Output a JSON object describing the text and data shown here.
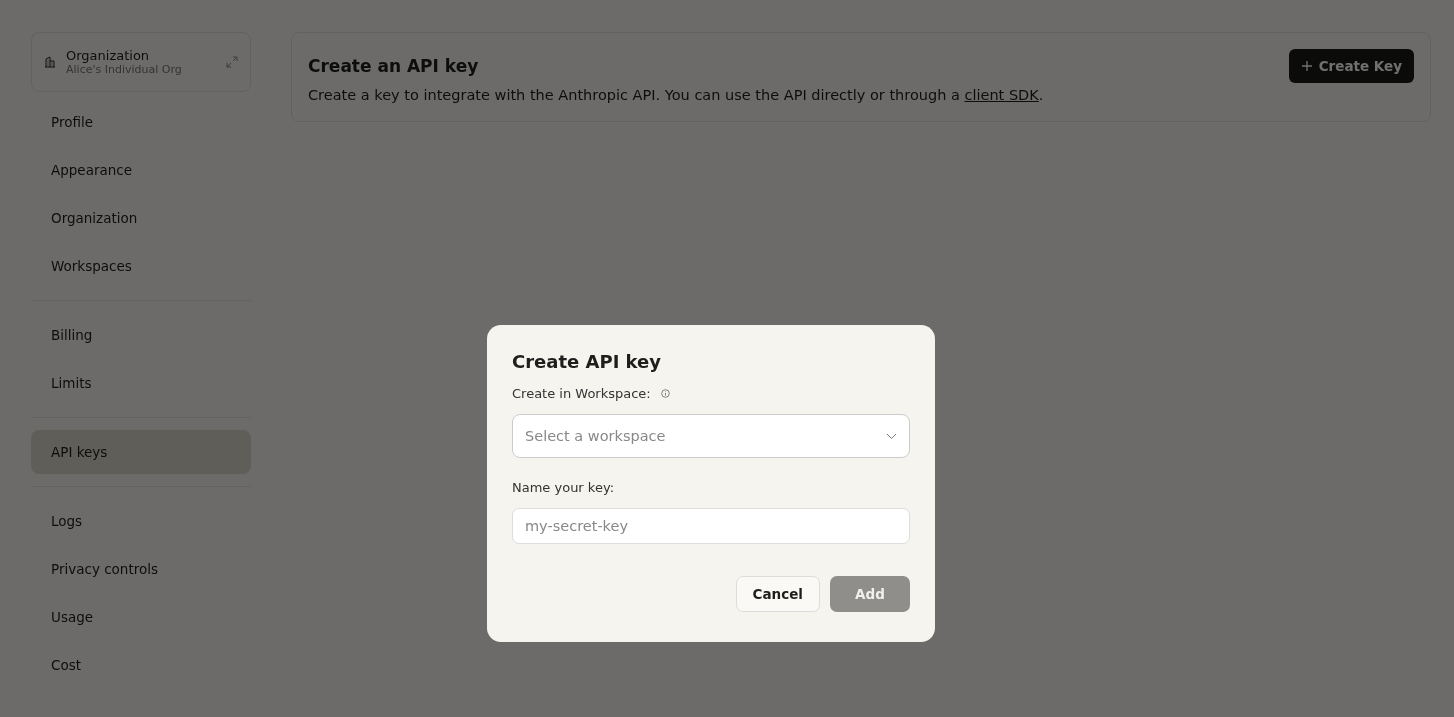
{
  "org": {
    "label": "Organization",
    "name": "Alice's Individual Org"
  },
  "sidebar": {
    "groups": [
      {
        "items": [
          {
            "label": "Profile",
            "selected": false
          },
          {
            "label": "Appearance",
            "selected": false
          },
          {
            "label": "Organization",
            "selected": false
          },
          {
            "label": "Workspaces",
            "selected": false
          }
        ]
      },
      {
        "items": [
          {
            "label": "Billing",
            "selected": false
          },
          {
            "label": "Limits",
            "selected": false
          }
        ]
      },
      {
        "items": [
          {
            "label": "API keys",
            "selected": true
          }
        ]
      },
      {
        "items": [
          {
            "label": "Logs",
            "selected": false
          },
          {
            "label": "Privacy controls",
            "selected": false
          },
          {
            "label": "Usage",
            "selected": false
          },
          {
            "label": "Cost",
            "selected": false
          }
        ]
      }
    ]
  },
  "header": {
    "title": "Create an API key",
    "description_before": "Create a key to integrate with the Anthropic API. You can use the API directly or through a ",
    "link": "client SDK",
    "description_after": ".",
    "create_button": "Create Key"
  },
  "dialog": {
    "title": "Create API key",
    "workspace_label": "Create in Workspace:",
    "workspace_select": {
      "placeholder": "Select a workspace"
    },
    "name_label": "Name your key:",
    "name_field": {
      "placeholder": "my-secret-key"
    },
    "buttons": [
      {
        "label": "Cancel",
        "kind": "secondary",
        "disabled": false
      },
      {
        "label": "Add",
        "kind": "primary",
        "disabled": true
      }
    ]
  }
}
